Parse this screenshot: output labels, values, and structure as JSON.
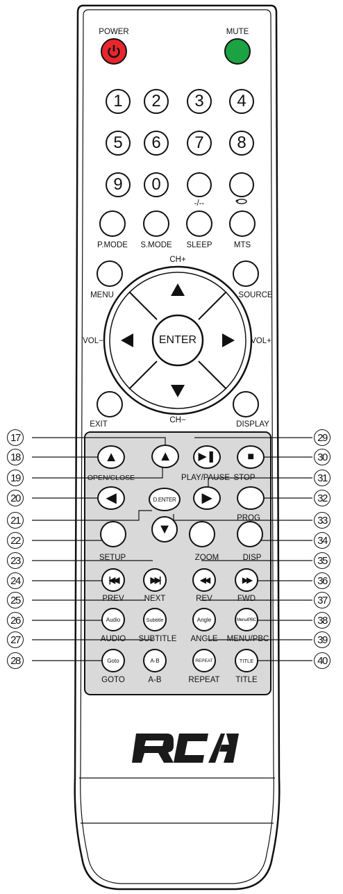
{
  "top": {
    "power": "POWER",
    "mute": "MUTE"
  },
  "colors": {
    "power": "#e8262d",
    "mute": "#1ba243",
    "panel": "#d9d9d9",
    "logo": "#1a1a1a"
  },
  "numbers": [
    "1",
    "2",
    "3",
    "4",
    "5",
    "6",
    "7",
    "8",
    "9",
    "0"
  ],
  "row3_labels": {
    "dash": "-/--",
    "recall_icon": "loop-arrow-icon"
  },
  "row4_labels": [
    "P.MODE",
    "S.MODE",
    "SLEEP",
    "MTS"
  ],
  "nav": {
    "ch_up": "CH+",
    "ch_down": "CH−",
    "vol_down": "VOL−",
    "vol_up": "VOL+",
    "enter": "ENTER",
    "menu": "MENU",
    "source": "SOURCE",
    "exit": "EXIT",
    "display": "DISPLAY"
  },
  "dvd": {
    "open_close": "OPEN/CLOSE",
    "play_pause": "PLAY/PAUSE",
    "stop": "STOP",
    "d_enter": "D.ENTER",
    "prog": "PROG",
    "setup": "SETUP",
    "zoom": "ZOOM",
    "disp": "DISP",
    "prev": "PREV",
    "next": "NEXT",
    "rev": "REV",
    "fwd": "FWD",
    "audio_btn": "Audio",
    "subtitle_btn": "Subtitle",
    "angle_btn": "Angle",
    "menupbc_btn": "Menu/PBC",
    "audio": "AUDIO",
    "subtitle": "SUBTITLE",
    "angle": "ANGLE",
    "menupbc": "MENU/PBC",
    "goto_btn": "Goto",
    "ab_btn": "A-B",
    "repeat_btn": "REPEAT",
    "title_btn": "TITLE",
    "goto": "GOTO",
    "ab": "A-B",
    "repeat": "REPEAT",
    "title": "TITLE"
  },
  "callouts_left": [
    "17",
    "18",
    "19",
    "20",
    "21",
    "22",
    "23",
    "24",
    "25",
    "26",
    "27",
    "28"
  ],
  "callouts_right": [
    "29",
    "30",
    "31",
    "32",
    "33",
    "34",
    "35",
    "36",
    "37",
    "38",
    "39",
    "40"
  ],
  "brand": "RCA"
}
